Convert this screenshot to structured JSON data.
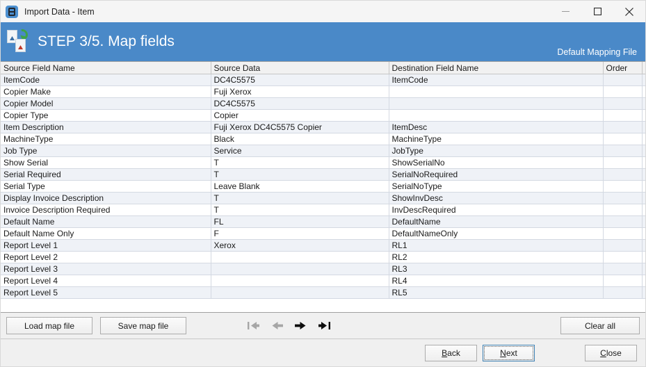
{
  "window": {
    "title": "Import Data - Item",
    "app_icon": "import-data-app-icon",
    "controls": {
      "minimize": "minimize-icon",
      "maximize": "maximize-icon",
      "close": "close-icon"
    }
  },
  "header": {
    "icon": "import-step-icon",
    "title": "STEP 3/5. Map fields",
    "mapping_file": "Default Mapping File",
    "background_color": "#4a89c8"
  },
  "grid": {
    "columns": [
      "Source Field Name",
      "Source Data",
      "Destination Field Name",
      "Order"
    ],
    "rows": [
      {
        "source_field": "ItemCode",
        "source_data": "DC4C5575",
        "destination_field": "ItemCode",
        "order": ""
      },
      {
        "source_field": "Copier Make",
        "source_data": "Fuji Xerox",
        "destination_field": "",
        "order": ""
      },
      {
        "source_field": "Copier Model",
        "source_data": "DC4C5575",
        "destination_field": "",
        "order": ""
      },
      {
        "source_field": "Copier Type",
        "source_data": "Copier",
        "destination_field": "",
        "order": ""
      },
      {
        "source_field": "Item Description",
        "source_data": "Fuji Xerox DC4C5575 Copier",
        "destination_field": "ItemDesc",
        "order": ""
      },
      {
        "source_field": "MachineType",
        "source_data": "Black",
        "destination_field": "MachineType",
        "order": ""
      },
      {
        "source_field": "Job Type",
        "source_data": "Service",
        "destination_field": "JobType",
        "order": ""
      },
      {
        "source_field": "Show Serial",
        "source_data": "T",
        "destination_field": "ShowSerialNo",
        "order": ""
      },
      {
        "source_field": "Serial Required",
        "source_data": "T",
        "destination_field": "SerialNoRequired",
        "order": ""
      },
      {
        "source_field": "Serial Type",
        "source_data": "Leave Blank",
        "destination_field": "SerialNoType",
        "order": ""
      },
      {
        "source_field": "Display Invoice Description",
        "source_data": "T",
        "destination_field": "ShowInvDesc",
        "order": ""
      },
      {
        "source_field": "Invoice Description Required",
        "source_data": "T",
        "destination_field": "InvDescRequired",
        "order": ""
      },
      {
        "source_field": "Default Name",
        "source_data": "FL",
        "destination_field": "DefaultName",
        "order": ""
      },
      {
        "source_field": "Default Name Only",
        "source_data": "F",
        "destination_field": "DefaultNameOnly",
        "order": ""
      },
      {
        "source_field": "Report Level 1",
        "source_data": "Xerox",
        "destination_field": "RL1",
        "order": ""
      },
      {
        "source_field": "Report Level 2",
        "source_data": "",
        "destination_field": "RL2",
        "order": ""
      },
      {
        "source_field": "Report Level 3",
        "source_data": "",
        "destination_field": "RL3",
        "order": ""
      },
      {
        "source_field": "Report Level 4",
        "source_data": "",
        "destination_field": "RL4",
        "order": ""
      },
      {
        "source_field": "Report Level 5",
        "source_data": "",
        "destination_field": "RL5",
        "order": ""
      }
    ]
  },
  "toolbar": {
    "load_map_file": "Load map file",
    "save_map_file": "Save map file",
    "clear_all": "Clear all",
    "nav": {
      "first": "go-to-first-icon",
      "previous": "go-to-previous-icon",
      "next": "go-to-next-icon",
      "last": "go-to-last-icon",
      "first_enabled": false,
      "previous_enabled": false,
      "next_enabled": true,
      "last_enabled": true
    }
  },
  "footer": {
    "back": {
      "prefix": "",
      "mnemonic": "B",
      "suffix": "ack"
    },
    "next": {
      "prefix": "",
      "mnemonic": "N",
      "suffix": "ext"
    },
    "close": {
      "prefix": "",
      "mnemonic": "C",
      "suffix": "lose"
    }
  }
}
